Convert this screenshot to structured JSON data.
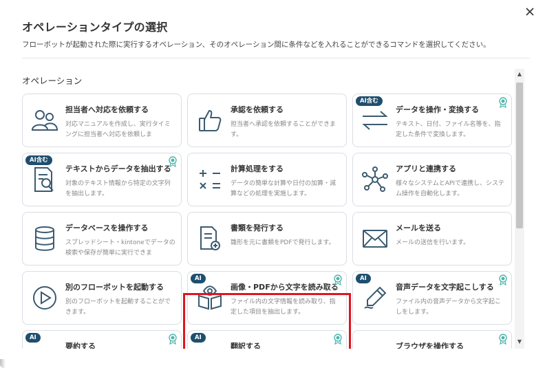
{
  "dialog": {
    "title": "オペレーションタイプの選択",
    "subtitle": "フローボットが起動された際に実行するオペレーション、そのオペレーション間に条件などを入れることができるコマンドを選択してください。",
    "close_icon": "close-icon"
  },
  "section": {
    "title": "オペレーション"
  },
  "colors": {
    "badge": "#1f4f6e",
    "highlight": "#e0141e",
    "ribbon": "#4db6ac",
    "icon": "#3a5a70"
  },
  "cards": [
    {
      "title": "担当者へ対応を依頼する",
      "desc": "対応マニュアルを作成し、実行タイミングに担当者へ対応を依頼しま",
      "icon": "users-icon",
      "badge": "",
      "ribbon": false
    },
    {
      "title": "承認を依頼する",
      "desc": "担当者へ承認を依頼することができます。",
      "icon": "thumbs-up-icon",
      "badge": "",
      "ribbon": false
    },
    {
      "title": "データを操作・変換する",
      "desc": "テキスト、日付、ファイル名等を、指定した条件で変換します。",
      "icon": "swap-arrows-icon",
      "badge": "AI含む",
      "ribbon": true
    },
    {
      "title": "テキストからデータを抽出する",
      "desc": "対象のテキスト情報から特定の文字列を抽出します。",
      "icon": "document-search-icon",
      "badge": "AI含む",
      "ribbon": true
    },
    {
      "title": "計算処理をする",
      "desc": "データの簡単な計算や日付の加算・減算などの処理を実施します。",
      "icon": "calculator-icon",
      "badge": "",
      "ribbon": false
    },
    {
      "title": "アプリと連携する",
      "desc": "様々なシステムとAPIで連携し、システム操作を自動化します。",
      "icon": "network-icon",
      "badge": "",
      "ribbon": false
    },
    {
      "title": "データベースを操作する",
      "desc": "スプレッドシート・kintoneでデータの検索や保存が簡単に実行できま",
      "icon": "database-icon",
      "badge": "",
      "ribbon": false
    },
    {
      "title": "書類を発行する",
      "desc": "雛形を元に書類をPDFで発行します。",
      "icon": "document-add-icon",
      "badge": "",
      "ribbon": false
    },
    {
      "title": "メールを送る",
      "desc": "メールの送信を行います。",
      "icon": "mail-icon",
      "badge": "",
      "ribbon": false
    },
    {
      "title": "別のフローボットを起動する",
      "desc": "別のフローボットを起動することができます。",
      "icon": "play-icon",
      "badge": "",
      "ribbon": false
    },
    {
      "title": "画像・PDFから文字を読み取る",
      "desc": "ファイル内の文字情報を読み取り、指定した項目を抽出します。",
      "icon": "book-eye-icon",
      "badge": "AI",
      "ribbon": true
    },
    {
      "title": "音声データを文字起こしする",
      "desc": "ファイル内の音声データから文字起こしをします。",
      "icon": "pen-icon",
      "badge": "AI",
      "ribbon": true
    },
    {
      "title": "要約する",
      "desc": "",
      "icon": "",
      "badge": "AI",
      "ribbon": true
    },
    {
      "title": "翻訳する",
      "desc": "",
      "icon": "",
      "badge": "AI",
      "ribbon": true
    },
    {
      "title": "ブラウザを操作する",
      "desc": "",
      "icon": "",
      "badge": "",
      "ribbon": true
    }
  ]
}
